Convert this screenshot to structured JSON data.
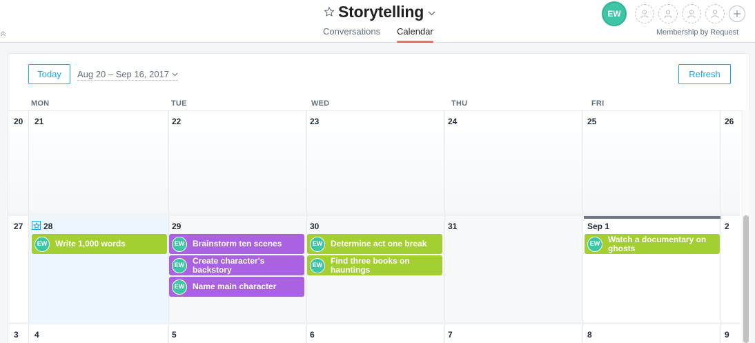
{
  "header": {
    "project_title": "Storytelling",
    "tabs": [
      {
        "label": "Conversations",
        "active": false
      },
      {
        "label": "Calendar",
        "active": true
      }
    ],
    "owner_initials": "EW",
    "membership_text": "Membership by Request",
    "colors": {
      "accent": "#14aaf5",
      "tab_underline": "#f06a6a",
      "avatar": "#3dc5a6"
    }
  },
  "toolbar": {
    "today_label": "Today",
    "date_range": "Aug 20 – Sep 16, 2017",
    "refresh_label": "Refresh"
  },
  "weekdays": [
    "MON",
    "TUE",
    "WED",
    "THU",
    "FRI"
  ],
  "weeks": [
    {
      "days": [
        "20",
        "21",
        "22",
        "23",
        "24",
        "25",
        "26"
      ]
    },
    {
      "days": [
        "27",
        "28",
        "29",
        "30",
        "31",
        "Sep 1",
        "2"
      ]
    },
    {
      "days": [
        "3",
        "4",
        "5",
        "6",
        "7",
        "8",
        "9"
      ]
    }
  ],
  "tasks": {
    "mon28": [
      {
        "assignee": "EW",
        "title": "Write 1,000 words",
        "color": "#a4cf30"
      }
    ],
    "tue29": [
      {
        "assignee": "EW",
        "title": "Brainstorm ten scenes",
        "color": "#aa62e3"
      },
      {
        "assignee": "EW",
        "title": "Create character's backstory",
        "color": "#aa62e3"
      },
      {
        "assignee": "EW",
        "title": "Name main character",
        "color": "#aa62e3"
      }
    ],
    "wed30": [
      {
        "assignee": "EW",
        "title": "Determine act one break",
        "color": "#a4cf30"
      },
      {
        "assignee": "EW",
        "title": "Find three books on hauntings",
        "color": "#a4cf30"
      }
    ],
    "fri1": [
      {
        "assignee": "EW",
        "title": "Watch a documentary on ghosts",
        "color": "#a4cf30"
      }
    ]
  }
}
